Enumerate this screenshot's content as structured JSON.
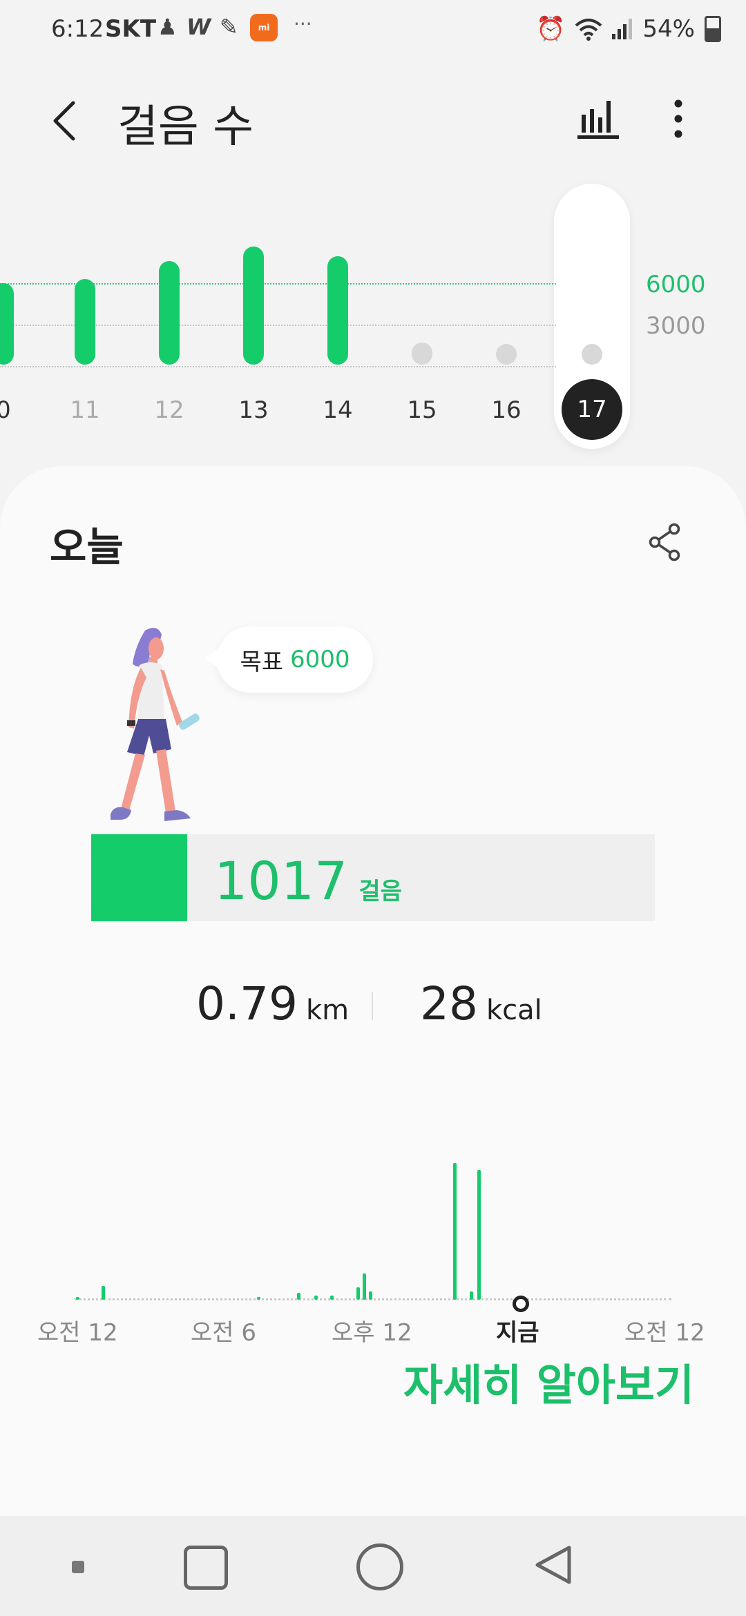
{
  "status_bar": {
    "time": "6:12",
    "carrier": "SKT",
    "more": "···",
    "battery_percent": "54%",
    "icons": [
      "notification-icon",
      "w-app-icon",
      "fitness-app-icon",
      "mi-app-icon",
      "alarm-icon",
      "wifi-icon",
      "signal-icon",
      "battery-icon"
    ]
  },
  "app_bar": {
    "title": "걸음 수",
    "icons": [
      "back-arrow-icon",
      "bar-chart-icon",
      "more-vert-icon"
    ]
  },
  "week_chart": {
    "days": [
      "0",
      "11",
      "12",
      "13",
      "14",
      "15",
      "16",
      "17"
    ],
    "selected_day": "17",
    "goal_label": "6000",
    "mid_label": "3000",
    "steps_relative_to_goal": [
      1.0,
      1.05,
      1.27,
      1.45,
      1.33,
      0.27,
      0.0,
      0.0
    ],
    "colors": {
      "accent": "#15cc6b",
      "inactive": "#d8d8d8",
      "selected": "#222222"
    }
  },
  "today": {
    "title": "오늘",
    "goal_label": "목표",
    "goal_value": "6000",
    "steps_value": "1017",
    "steps_unit": "걸음",
    "progress_fraction": 0.17,
    "distance_value": "0.79",
    "distance_unit": "km",
    "calories_value": "28",
    "calories_unit": "kcal",
    "day_chart": {
      "labels": [
        "오전 12",
        "오전 6",
        "오후 12",
        "지금",
        "오전 12"
      ],
      "now_label": "지금"
    },
    "more_link": "자세히 알아보기"
  },
  "nav_bar": {
    "icons": [
      "recent-apps-icon",
      "home-icon",
      "back-icon"
    ]
  }
}
